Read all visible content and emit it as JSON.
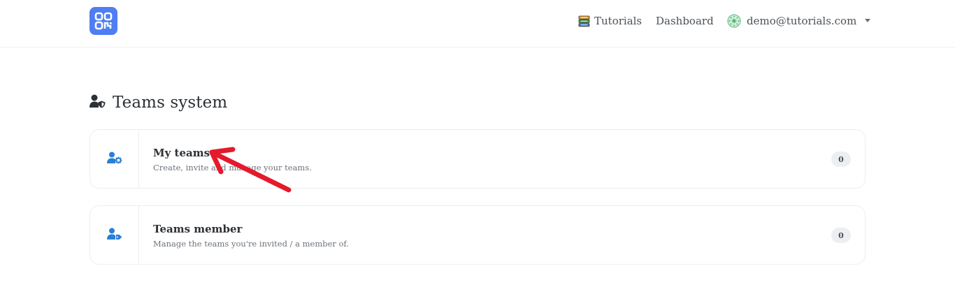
{
  "colors": {
    "accent": "#4f7df3",
    "icon_blue": "#2a7fd4",
    "annotation_red": "#e41a2c"
  },
  "nav": {
    "logo_icon": "qr-code-logo",
    "tutorials_label": "Tutorials",
    "tutorials_icon": "books-icon",
    "dashboard_label": "Dashboard",
    "user_email": "demo@tutorials.com",
    "user_avatar_icon": "globe-avatar-icon",
    "user_menu_icon": "caret-down-icon"
  },
  "page": {
    "title": "Teams system",
    "title_icon": "user-shield-icon"
  },
  "cards": [
    {
      "title": "My teams",
      "description": "Create, invite and manage your teams.",
      "count": "0",
      "icon": "user-cog-icon"
    },
    {
      "title": "Teams member",
      "description": "Manage the teams you're invited / a member of.",
      "count": "0",
      "icon": "user-tag-icon"
    }
  ],
  "annotation": {
    "type": "red-arrow",
    "target": "My teams"
  }
}
